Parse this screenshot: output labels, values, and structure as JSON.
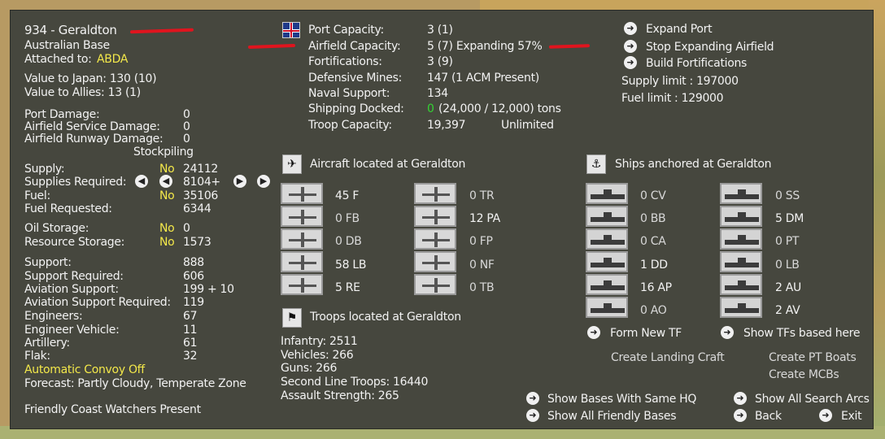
{
  "base": {
    "title": "934 - Geraldton",
    "type": "Australian Base",
    "attached_label": "Attached to:",
    "attached_value": "ABDA",
    "value_japan": "Value to Japan: 130 (10)",
    "value_allies": "Value to Allies: 13 (1)"
  },
  "damage": [
    {
      "label": "Port Damage:",
      "value": "0"
    },
    {
      "label": "Airfield Service Damage:",
      "value": "0"
    },
    {
      "label": "Airfield Runway Damage:",
      "value": "0"
    }
  ],
  "stockpiling": "Stockpiling",
  "supply": {
    "supply_label": "Supply:",
    "supply_flag": "No",
    "supply_value": "24112",
    "required_label": "Supplies Required:",
    "required_value": "8104+",
    "fuel_label": "Fuel:",
    "fuel_flag": "No",
    "fuel_value": "35106",
    "fuel_req_label": "Fuel Requested:",
    "fuel_req_value": "6344",
    "oil_label": "Oil Storage:",
    "oil_flag": "No",
    "oil_value": "0",
    "res_label": "Resource Storage:",
    "res_flag": "No",
    "res_value": "1573"
  },
  "support": [
    {
      "label": "Support:",
      "value": "888"
    },
    {
      "label": "Support Required:",
      "value": "606"
    },
    {
      "label": "Aviation Support:",
      "value": "199 + 10"
    },
    {
      "label": "Aviation Support Required:",
      "value": "119"
    },
    {
      "label": "Engineers:",
      "value": "67"
    },
    {
      "label": "Engineer Vehicle:",
      "value": "11"
    },
    {
      "label": "Artillery:",
      "value": "61"
    },
    {
      "label": "Flak:",
      "value": "32"
    }
  ],
  "convoy": "Automatic Convoy Off",
  "forecast": "Forecast: Partly Cloudy, Temperate Zone",
  "coast_watchers": "Friendly Coast Watchers Present",
  "port_info": {
    "port_capacity_label": "Port Capacity:",
    "port_capacity_value": "3 (1)",
    "airfield_capacity_label": "Airfield Capacity:",
    "airfield_capacity_value": "5 (7) Expanding 57%",
    "fortifications_label": "Fortifications:",
    "fortifications_value": "3 (9)",
    "mines_label": "Defensive Mines:",
    "mines_value": "147 (1 ACM Present)",
    "naval_label": "Naval Support:",
    "naval_value": "134",
    "shipping_label": "Shipping Docked:",
    "shipping_count": "0",
    "shipping_value": "(24,000 / 12,000) tons",
    "troop_label": "Troop Capacity:",
    "troop_value": "19,397",
    "troop_unlimited": "Unlimited"
  },
  "actions_top": {
    "expand_port": "Expand Port",
    "stop_expanding": "Stop Expanding Airfield",
    "build_fort": "Build Fortifications",
    "supply_limit": "Supply limit : 197000",
    "fuel_limit": "Fuel limit : 129000"
  },
  "aircraft": {
    "header": "Aircraft located at Geraldton",
    "col1": [
      "45 F",
      "0 FB",
      "0 DB",
      "58 LB",
      "5 RE"
    ],
    "col2": [
      "0 TR",
      "12 PA",
      "0 FP",
      "0 NF",
      "0 TB"
    ]
  },
  "ships": {
    "header": "Ships anchored at Geraldton",
    "col1": [
      "0 CV",
      "0 BB",
      "0 CA",
      "1 DD",
      "16 AP",
      "0 AO"
    ],
    "col2": [
      "0 SS",
      "5 DM",
      "0 PT",
      "0 LB",
      "2 AU",
      "2 AV"
    ]
  },
  "troops": {
    "header": "Troops located at Geraldton",
    "infantry": "Infantry: 2511",
    "vehicles": "Vehicles: 266",
    "guns": "Guns: 266",
    "second_line": "Second Line Troops: 16440",
    "assault": "Assault Strength: 265"
  },
  "tf": {
    "form_new": "Form New TF",
    "show_tfs": "Show TFs based here",
    "landing": "Create Landing Craft",
    "pt_boats": "Create PT Boats",
    "mcbs": "Create MCBs"
  },
  "bottom": {
    "same_hq": "Show Bases With Same HQ",
    "friendly": "Show All Friendly Bases",
    "search_arcs": "Show All Search Arcs",
    "back": "Back",
    "exit": "Exit"
  }
}
